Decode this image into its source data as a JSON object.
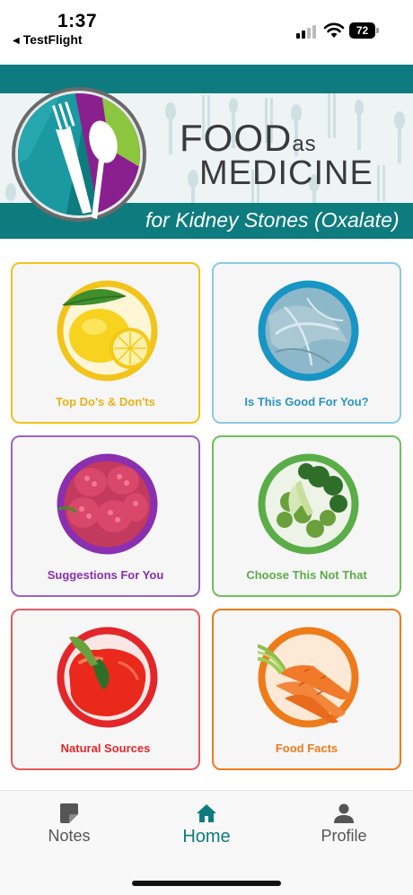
{
  "status": {
    "time": "1:37",
    "back_app": "TestFlight",
    "battery": "72"
  },
  "banner": {
    "title_food": "FOOD",
    "title_as": "as",
    "title_medicine": "MEDICINE",
    "subtitle": "for Kidney Stones (Oxalate)",
    "colors": {
      "teal": "#0e7c7e"
    }
  },
  "cards": [
    {
      "label": "Top Do's & Don'ts",
      "color": "#f2c31b",
      "icon": "lemon-image"
    },
    {
      "label": "Is This Good For You?",
      "color": "#3ba3c9",
      "icon": "cabbage-image"
    },
    {
      "label": "Suggestions For You",
      "color": "#8a2fb0",
      "icon": "raspberry-image"
    },
    {
      "label": "Choose This Not That",
      "color": "#5aad48",
      "icon": "broccoli-image"
    },
    {
      "label": "Natural Sources",
      "color": "#e3262a",
      "icon": "pepper-image"
    },
    {
      "label": "Food Facts",
      "color": "#ee7b1a",
      "icon": "carrot-image"
    }
  ],
  "tabbar": {
    "notes": "Notes",
    "home": "Home",
    "profile": "Profile",
    "active_color": "#0e7c7e",
    "inactive_color": "#555555"
  }
}
